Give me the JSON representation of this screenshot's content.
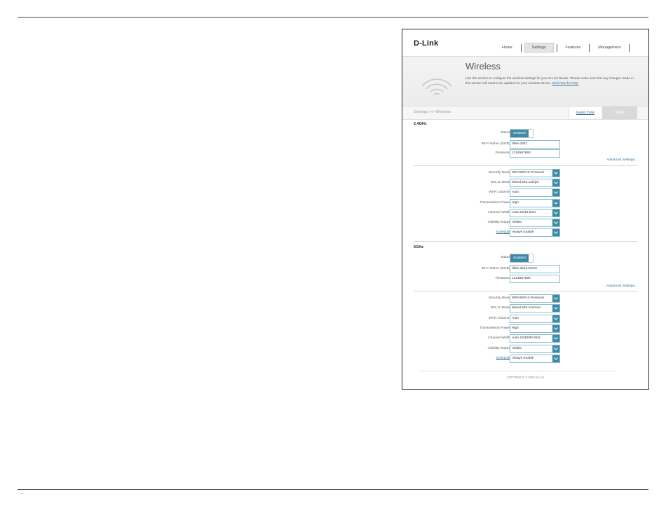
{
  "header": {
    "logo": "D-Link",
    "nav": [
      "Home",
      "Settings",
      "Features",
      "Management"
    ],
    "active_nav": "Settings"
  },
  "banner": {
    "title": "Wireless",
    "description": "Use this section to configure the wireless settings for your D-Link Router. Please make sure that any changes made in this section will need to be updated on your wireless device.",
    "help_link": "Click here for help."
  },
  "bar": {
    "breadcrumb": "Settings >> Wireless",
    "guest_zone": "Guest Zone",
    "save": "Save"
  },
  "band24": {
    "title": "2.4GHz",
    "status_label": "Status:",
    "status_value": "Enabled",
    "ssid_label": "Wi-Fi Name (SSID):",
    "ssid_value": "dlink-d331",
    "password_label": "Password:",
    "password_value": "1234567890",
    "advanced": "Advanced Settings...",
    "selects": [
      {
        "label": "Security Mode:",
        "value": "WPA/WPA2-Personal"
      },
      {
        "label": "802.11 Mode:",
        "value": "Mixed 802.11b/g/n"
      },
      {
        "label": "Wi-Fi Channel:",
        "value": "Auto"
      },
      {
        "label": "Transmission Power:",
        "value": "High"
      },
      {
        "label": "Channel Width:",
        "value": "Auto 20/40 MHz"
      },
      {
        "label": "Visibility Status:",
        "value": "Visible"
      },
      {
        "label": "Schedule:",
        "value": "Always Enable"
      }
    ]
  },
  "band5": {
    "title": "5GHz",
    "status_label": "Status:",
    "status_value": "Enabled",
    "ssid_label": "Wi-Fi Name (SSID):",
    "ssid_value": "dlink-d224-5GHz",
    "password_label": "Password:",
    "password_value": "1234567890",
    "advanced": "Advanced Settings...",
    "selects": [
      {
        "label": "Security Mode:",
        "value": "WPA/WPA2-Personal"
      },
      {
        "label": "802.11 Mode:",
        "value": "Mixed 802.11a/n/ac"
      },
      {
        "label": "Wi-Fi Channel:",
        "value": "Auto"
      },
      {
        "label": "Transmission Power:",
        "value": "High"
      },
      {
        "label": "Channel Width:",
        "value": "Auto 20/40/80 MHz"
      },
      {
        "label": "Visibility Status:",
        "value": "Visible"
      },
      {
        "label": "Schedule:",
        "value": "Always Enable"
      }
    ]
  },
  "footer": {
    "copyright": "COPYRIGHT © 2015 D-Link"
  },
  "colors": {
    "accent": "#3d8aa6",
    "link": "#2a6a90"
  }
}
